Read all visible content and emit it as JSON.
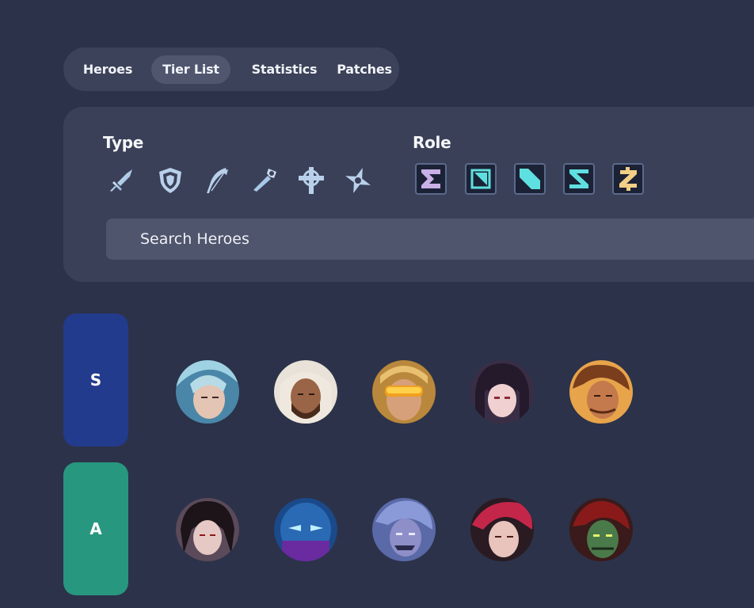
{
  "nav": {
    "tabs": [
      {
        "label": "Heroes"
      },
      {
        "label": "Tier List"
      },
      {
        "label": "Statistics"
      },
      {
        "label": "Patches"
      }
    ],
    "active_tab": "Tier List"
  },
  "filters": {
    "type_title": "Type",
    "type_icons": [
      "sword-icon",
      "shield-icon",
      "bow-icon",
      "staff-icon",
      "cross-icon",
      "shuriken-icon"
    ],
    "role_title": "Role",
    "role_icons": [
      "role-sigma-icon",
      "role-square-icon",
      "role-slash-icon",
      "role-s-icon",
      "role-z-icon"
    ],
    "role_colors": [
      "#c9b0e6",
      "#5fe0e0",
      "#5fe0e0",
      "#5fe0e0",
      "#f2cf86"
    ],
    "accent_icon_color": "#a9c7e8",
    "search_placeholder": "Search Heroes"
  },
  "tiers": [
    {
      "label": "S",
      "color": "#233b8c",
      "heroes": [
        "hero-portrait",
        "hero-portrait",
        "hero-portrait",
        "hero-portrait",
        "hero-portrait"
      ]
    },
    {
      "label": "A",
      "color": "#27977f",
      "heroes": [
        "hero-portrait",
        "hero-portrait",
        "hero-portrait",
        "hero-portrait",
        "hero-portrait"
      ]
    }
  ]
}
